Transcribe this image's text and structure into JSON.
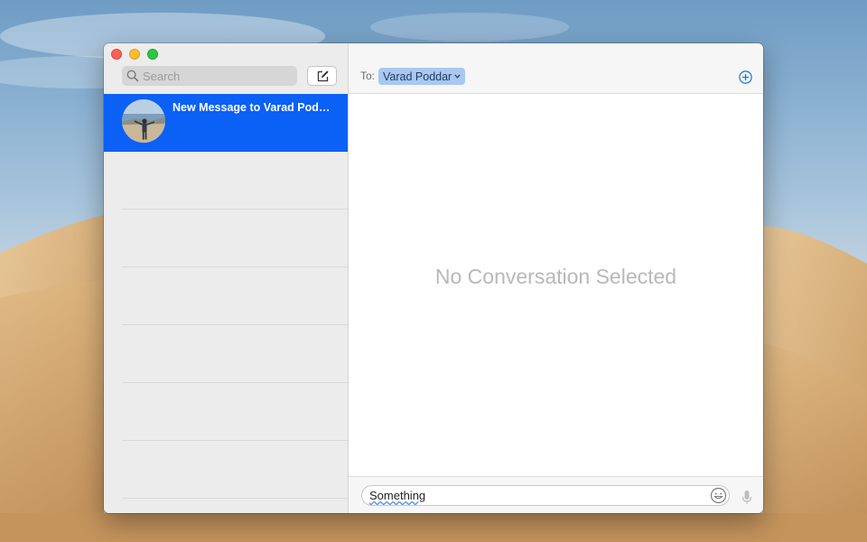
{
  "sidebar": {
    "search_placeholder": "Search",
    "conversations": [
      {
        "title": "New Message to Varad Pod…",
        "selected": true
      }
    ]
  },
  "compose": {
    "to_label": "To:",
    "recipient": "Varad Poddar"
  },
  "main": {
    "empty_state": "No Conversation Selected"
  },
  "message_input": {
    "value": "Something"
  },
  "colors": {
    "selection": "#0b60f5",
    "recipient_token": "#a9c8f0",
    "accent": "#1a73d9"
  },
  "icons": {
    "window_controls": [
      "close-icon",
      "minimize-icon",
      "zoom-icon"
    ],
    "search": "search-icon",
    "compose": "compose-icon",
    "add": "plus-circle-icon",
    "emoji": "emoji-icon",
    "mic": "microphone-icon"
  }
}
